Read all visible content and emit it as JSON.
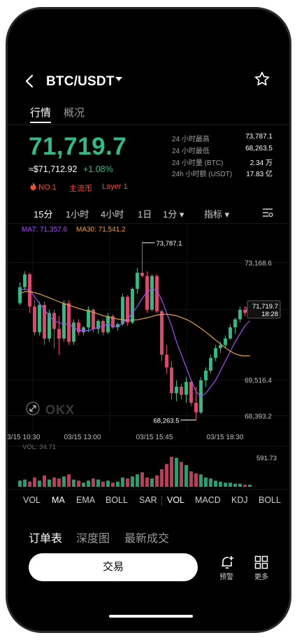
{
  "header": {
    "pair": "BTC/USDT",
    "back_icon": "chevron-left-icon",
    "dropdown_icon": "caret-down-icon",
    "favorite_icon": "star-outline-icon"
  },
  "tabs": [
    {
      "label": "行情",
      "active": true
    },
    {
      "label": "概况",
      "active": false
    }
  ],
  "ticker": {
    "price": "71,719.7",
    "fiat_price": "≈$71,712.92",
    "change": "+1.08%",
    "tags": [
      "NO.1",
      "主流币",
      "Layer 1"
    ]
  },
  "stats": [
    {
      "label": "24 小时最高",
      "value": "73,787.1"
    },
    {
      "label": "24 小时最低",
      "value": "68,263.5"
    },
    {
      "label": "24 小时量 (BTC)",
      "value": "2.34 万"
    },
    {
      "label": "24h 小时额 (USDT)",
      "value": "17.83 亿"
    }
  ],
  "timeframes": [
    "15分",
    "1小时",
    "4小时",
    "1日",
    "1分 ▾",
    "指标 ▾"
  ],
  "ma_labels": {
    "ma7": "MA7: 71,357.6",
    "ma30": "MA30: 71,541.2",
    "vol": "VOL: 34.71",
    "vol_axis": "591.73"
  },
  "chart_data": {
    "type": "candlestick",
    "y_ticks": [
      "73,168.6",
      "71,702.8",
      "69,516.4",
      "68,393.2"
    ],
    "x_ticks": [
      "03/15 10:30",
      "03/15 13:00",
      "03/15 15:45",
      "03/15 18:30"
    ],
    "high_annotation": "73,787.1",
    "low_annotation": "68,263.5",
    "current_price_label": "71,719.7",
    "countdown": "18:28",
    "ylim": [
      68100,
      74200
    ],
    "candles": [
      [
        71900,
        72550,
        71850,
        72400
      ],
      [
        72400,
        72900,
        72300,
        72800
      ],
      [
        72800,
        72850,
        71600,
        71800
      ],
      [
        71800,
        72000,
        70900,
        71000
      ],
      [
        71000,
        71950,
        70900,
        71850
      ],
      [
        71850,
        71950,
        70600,
        70800
      ],
      [
        70800,
        71700,
        70700,
        71600
      ],
      [
        71600,
        71700,
        70500,
        71100
      ],
      [
        71100,
        71500,
        70300,
        70800
      ],
      [
        70800,
        72000,
        70700,
        71900
      ],
      [
        71900,
        72000,
        70600,
        70700
      ],
      [
        70700,
        71400,
        70600,
        71300
      ],
      [
        71300,
        71400,
        70900,
        71000
      ],
      [
        71000,
        71200,
        70900,
        71150
      ],
      [
        71150,
        71800,
        71000,
        71700
      ],
      [
        71700,
        71750,
        71000,
        71100
      ],
      [
        71100,
        71400,
        70950,
        71350
      ],
      [
        71350,
        71400,
        70900,
        71000
      ],
      [
        71000,
        71600,
        70950,
        71500
      ],
      [
        71500,
        71550,
        71100,
        71150
      ],
      [
        71150,
        71300,
        71050,
        71250
      ],
      [
        71250,
        72200,
        71200,
        72100
      ],
      [
        72100,
        72150,
        71200,
        71300
      ],
      [
        71300,
        72400,
        71250,
        72350
      ],
      [
        72350,
        73000,
        72200,
        72850
      ],
      [
        72850,
        73787,
        72700,
        72750
      ],
      [
        72750,
        72900,
        71600,
        71700
      ],
      [
        71700,
        72800,
        71650,
        72750
      ],
      [
        72750,
        72800,
        71600,
        71650
      ],
      [
        71650,
        71700,
        70100,
        70300
      ],
      [
        70300,
        70600,
        69700,
        69900
      ],
      [
        69900,
        70100,
        68900,
        69100
      ],
      [
        69100,
        69500,
        68850,
        69300
      ],
      [
        69300,
        69400,
        68900,
        69050
      ],
      [
        69050,
        69600,
        68800,
        69450
      ],
      [
        69450,
        69500,
        68700,
        68800
      ],
      [
        68800,
        69300,
        68263,
        68500
      ],
      [
        68500,
        69600,
        68450,
        69500
      ],
      [
        69500,
        69900,
        69300,
        69800
      ],
      [
        69800,
        70300,
        69700,
        70200
      ],
      [
        70200,
        70600,
        70100,
        70500
      ],
      [
        70500,
        70700,
        70350,
        70600
      ],
      [
        70600,
        70900,
        70500,
        70800
      ],
      [
        70800,
        71250,
        70750,
        71150
      ],
      [
        71150,
        71450,
        70950,
        71400
      ],
      [
        71400,
        71800,
        71300,
        71700
      ],
      [
        71700,
        71800,
        71500,
        71600
      ],
      [
        71600,
        71850,
        71550,
        71720
      ]
    ],
    "volumes": [
      6,
      7,
      5,
      9,
      6,
      11,
      7,
      9,
      8,
      10,
      12,
      7,
      6,
      4,
      6,
      8,
      7,
      5,
      6,
      4,
      5,
      9,
      8,
      10,
      12,
      14,
      9,
      8,
      11,
      17,
      22,
      29,
      28,
      24,
      21,
      15,
      13,
      12,
      9,
      8,
      6,
      5,
      4,
      4,
      3,
      3,
      2,
      2
    ],
    "ma7": [
      72300,
      72350,
      72300,
      72100,
      71900,
      71700,
      71500,
      71350,
      71300,
      71250,
      71250,
      71150,
      71050,
      71050,
      71050,
      71100,
      71150,
      71200,
      71250,
      71200,
      71150,
      71300,
      71400,
      71600,
      71800,
      72050,
      72250,
      72350,
      72300,
      72000,
      71600,
      71200,
      70700,
      70300,
      69900,
      69500,
      69150,
      69000,
      69100,
      69300,
      69500,
      69800,
      70100,
      70400,
      70700,
      70950,
      71200,
      71357
    ]
  },
  "chart_watermark": "OKX",
  "expand_icon": "expand-arrows-icon",
  "indicators": [
    "VOL",
    "MA",
    "EMA",
    "BOLL",
    "SAR",
    "VOL",
    "MACD",
    "KDJ",
    "BOLL"
  ],
  "indicators_active": [
    "MA",
    "VOL"
  ],
  "orderbook_tabs": [
    "订单表",
    "深度图",
    "最新成交"
  ],
  "bottom": {
    "trade_label": "交易",
    "alert_label": "预警",
    "alert_icon": "bell-plus-icon",
    "more_label": "更多",
    "more_icon": "grid-icon"
  },
  "colors": {
    "up": "#2ebd85",
    "down": "#e2466b",
    "ma7": "#a64dff",
    "ma30": "#e8a13a"
  }
}
